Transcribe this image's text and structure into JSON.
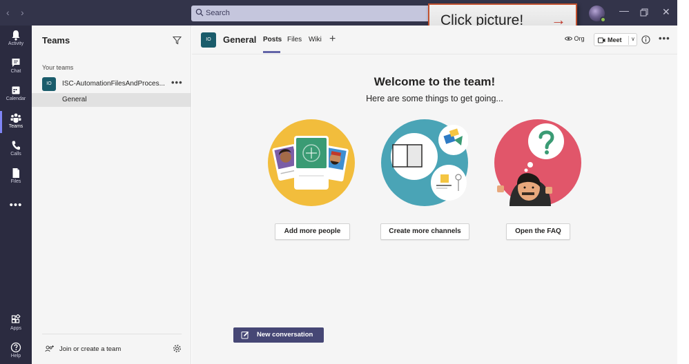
{
  "titlebar": {
    "search_placeholder": "Search",
    "back_icon": "chevron-left-icon",
    "forward_icon": "chevron-right-icon",
    "window_controls": [
      "minimize-icon",
      "restore-icon",
      "close-icon"
    ]
  },
  "tooltip": {
    "text": "Click picture!",
    "arrow_icon": "arrow-right-icon",
    "border_color": "#c1502e"
  },
  "rail": {
    "items": [
      {
        "label": "Activity",
        "icon": "bell-icon"
      },
      {
        "label": "Chat",
        "icon": "chat-icon"
      },
      {
        "label": "Calendar",
        "icon": "calendar-icon"
      },
      {
        "label": "Teams",
        "icon": "teams-icon",
        "active": true
      },
      {
        "label": "Calls",
        "icon": "phone-icon"
      },
      {
        "label": "Files",
        "icon": "file-icon"
      }
    ],
    "more": "•••",
    "bottom_items": [
      {
        "label": "Apps",
        "icon": "apps-icon"
      },
      {
        "label": "Help",
        "icon": "help-icon"
      }
    ]
  },
  "teams_pane": {
    "title": "Teams",
    "section_label": "Your teams",
    "team": {
      "initials": "IO",
      "name": "ISC-AutomationFilesAndProces...",
      "more": "•••"
    },
    "channel": "General",
    "join_label": "Join or create a team"
  },
  "channel_header": {
    "initials": "IO",
    "title": "General",
    "tabs": [
      "Posts",
      "Files",
      "Wiki"
    ],
    "active_tab": "Posts",
    "add_tab": "+",
    "org_label": "Org",
    "meet_label": "Meet",
    "more": "•••"
  },
  "welcome": {
    "title": "Welcome to the team!",
    "subtitle": "Here are some things to get going...",
    "actions": [
      {
        "label": "Add more people",
        "illustration": "people-cards-illustration",
        "bg": "#f2bd3c"
      },
      {
        "label": "Create more channels",
        "illustration": "channels-illustration",
        "bg": "#4aa4b6"
      },
      {
        "label": "Open the FAQ",
        "illustration": "faq-illustration",
        "bg": "#e1566a"
      }
    ]
  },
  "compose": {
    "new_conversation": "New conversation"
  },
  "colors": {
    "brand": "#6264a7",
    "titlebar": "#33344a",
    "rail": "#2b2b40",
    "team_avatar": "#1a5c6b",
    "compose_button": "#464775"
  }
}
